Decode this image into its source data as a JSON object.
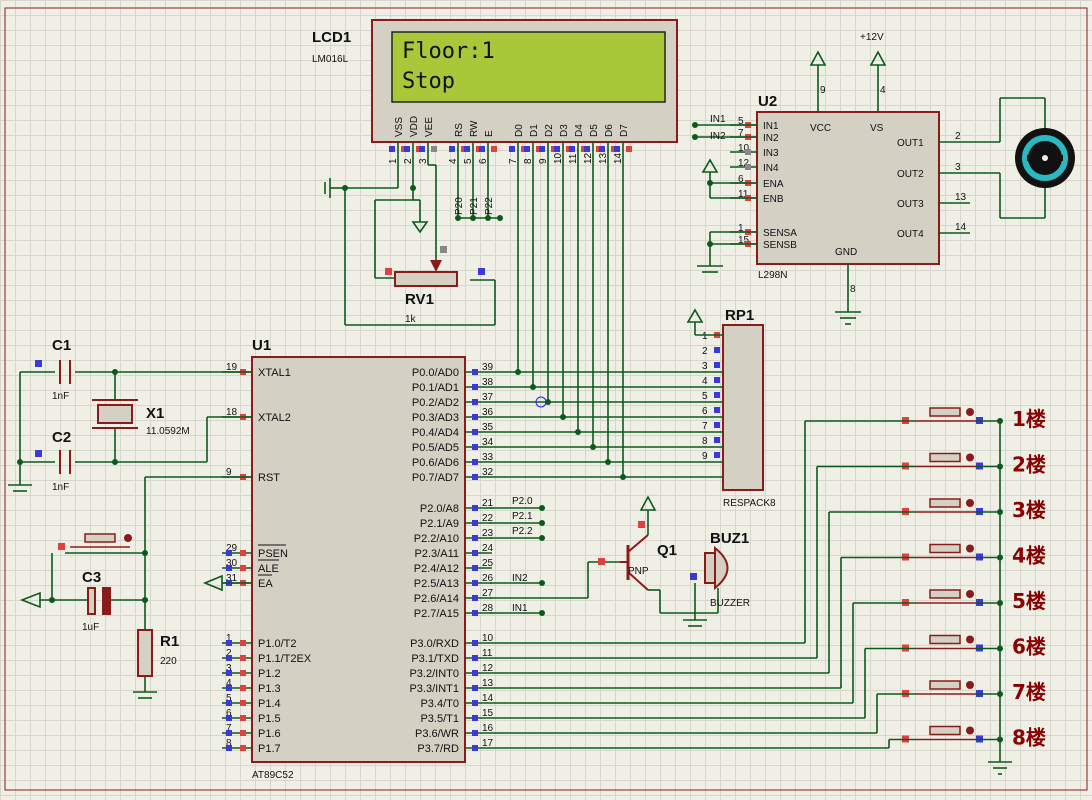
{
  "lcd": {
    "ref": "LCD1",
    "model": "LM016L",
    "line1": "Floor:1",
    "line2": "Stop",
    "screen_color": "#a8c83a",
    "pins": [
      {
        "name": "VSS",
        "num": "1"
      },
      {
        "name": "VDD",
        "num": "2"
      },
      {
        "name": "VEE",
        "num": "3"
      },
      {
        "name": "RS",
        "num": "4"
      },
      {
        "name": "RW",
        "num": "5"
      },
      {
        "name": "E",
        "num": "6"
      },
      {
        "name": "D0",
        "num": "7"
      },
      {
        "name": "D1",
        "num": "8"
      },
      {
        "name": "D2",
        "num": "9"
      },
      {
        "name": "D3",
        "num": "10"
      },
      {
        "name": "D4",
        "num": "11"
      },
      {
        "name": "D5",
        "num": "12"
      },
      {
        "name": "D6",
        "num": "13"
      },
      {
        "name": "D7",
        "num": "14"
      }
    ],
    "port_labels": [
      "P20",
      "P21",
      "P22"
    ]
  },
  "rv1": {
    "ref": "RV1",
    "value": "1k"
  },
  "u2": {
    "ref": "U2",
    "model": "L298N",
    "left_pins": [
      {
        "name": "IN1",
        "num": "5"
      },
      {
        "name": "IN2",
        "num": "7"
      },
      {
        "name": "IN3",
        "num": "10"
      },
      {
        "name": "IN4",
        "num": "12"
      },
      {
        "name": "ENA",
        "num": "6"
      },
      {
        "name": "ENB",
        "num": "11"
      },
      {
        "name": "SENSA",
        "num": "1"
      },
      {
        "name": "SENSB",
        "num": "15"
      }
    ],
    "net_labels": [
      "IN1",
      "IN2"
    ],
    "right_pins": [
      {
        "name": "OUT1",
        "num": "2"
      },
      {
        "name": "OUT2",
        "num": "3"
      },
      {
        "name": "OUT3",
        "num": "13"
      },
      {
        "name": "OUT4",
        "num": "14"
      }
    ],
    "top_pins": [
      {
        "name": "VCC",
        "num": "9"
      },
      {
        "name": "VS",
        "num": "4"
      }
    ],
    "gnd": {
      "name": "GND",
      "num": "8"
    },
    "supply": "+12V"
  },
  "rp1": {
    "ref": "RP1",
    "model": "RESPACK8",
    "pins": [
      "1",
      "2",
      "3",
      "4",
      "5",
      "6",
      "7",
      "8",
      "9"
    ]
  },
  "u1": {
    "ref": "U1",
    "model": "AT89C52",
    "left_pins": [
      {
        "name": "XTAL1",
        "num": "19"
      },
      {
        "name": "XTAL2",
        "num": "18"
      },
      {
        "name": "RST",
        "num": "9"
      },
      {
        "name": "PSEN",
        "num": "29"
      },
      {
        "name": "ALE",
        "num": "30"
      },
      {
        "name": "EA",
        "num": "31"
      },
      {
        "name": "P1.0/T2",
        "num": "1"
      },
      {
        "name": "P1.1/T2EX",
        "num": "2"
      },
      {
        "name": "P1.2",
        "num": "3"
      },
      {
        "name": "P1.3",
        "num": "4"
      },
      {
        "name": "P1.4",
        "num": "5"
      },
      {
        "name": "P1.5",
        "num": "6"
      },
      {
        "name": "P1.6",
        "num": "7"
      },
      {
        "name": "P1.7",
        "num": "8"
      }
    ],
    "p0_pins": [
      {
        "name": "P0.0/AD0",
        "num": "39"
      },
      {
        "name": "P0.1/AD1",
        "num": "38"
      },
      {
        "name": "P0.2/AD2",
        "num": "37"
      },
      {
        "name": "P0.3/AD3",
        "num": "36"
      },
      {
        "name": "P0.4/AD4",
        "num": "35"
      },
      {
        "name": "P0.5/AD5",
        "num": "34"
      },
      {
        "name": "P0.6/AD6",
        "num": "33"
      },
      {
        "name": "P0.7/AD7",
        "num": "32"
      }
    ],
    "p2_pins": [
      {
        "name": "P2.0/A8",
        "num": "21"
      },
      {
        "name": "P2.1/A9",
        "num": "22"
      },
      {
        "name": "P2.2/A10",
        "num": "23"
      },
      {
        "name": "P2.3/A11",
        "num": "24"
      },
      {
        "name": "P2.4/A12",
        "num": "25"
      },
      {
        "name": "P2.5/A13",
        "num": "26"
      },
      {
        "name": "P2.6/A14",
        "num": "27"
      },
      {
        "name": "P2.7/A15",
        "num": "28"
      }
    ],
    "p3_pins": [
      {
        "name": "P3.0/RXD",
        "num": "10"
      },
      {
        "name": "P3.1/TXD",
        "num": "11"
      },
      {
        "name": "P3.2/INT0",
        "num": "12"
      },
      {
        "name": "P3.3/INT1",
        "num": "13"
      },
      {
        "name": "P3.4/T0",
        "num": "14"
      },
      {
        "name": "P3.5/T1",
        "num": "15"
      },
      {
        "name": "P3.6/WR",
        "num": "16"
      },
      {
        "name": "P3.7/RD",
        "num": "17"
      }
    ],
    "p2_net_labels": [
      "P2.0",
      "P2.1",
      "P2.2",
      "IN2",
      "IN1"
    ]
  },
  "c1": {
    "ref": "C1",
    "value": "1nF"
  },
  "c2": {
    "ref": "C2",
    "value": "1nF"
  },
  "c3": {
    "ref": "C3",
    "value": "1uF"
  },
  "x1": {
    "ref": "X1",
    "value": "11.0592M"
  },
  "r1": {
    "ref": "R1",
    "value": "220"
  },
  "q1": {
    "ref": "Q1",
    "type": "PNP"
  },
  "buz1": {
    "ref": "BUZ1",
    "model": "BUZZER"
  },
  "floors": [
    "1楼",
    "2楼",
    "3楼",
    "4楼",
    "5楼",
    "6楼",
    "7楼",
    "8楼"
  ]
}
